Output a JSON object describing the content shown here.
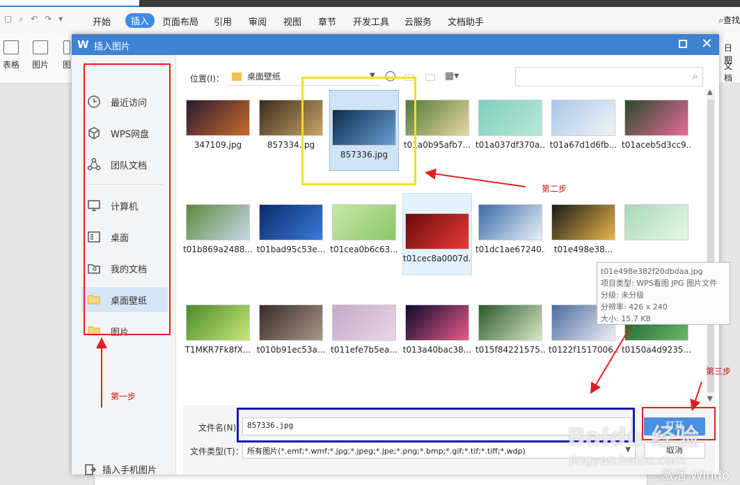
{
  "app": {
    "menu_tabs": [
      "开始",
      "插入",
      "页面布局",
      "引用",
      "审阅",
      "视图",
      "章节",
      "开发工具",
      "云服务",
      "文档助手"
    ],
    "active_tab": "插入",
    "search_label": "查找",
    "ribbon": {
      "table": "表格",
      "picture": "图片",
      "shape_partial": "图",
      "date_partial": "日期",
      "doc_partial": "文档"
    }
  },
  "dialog": {
    "title": "插入图片",
    "sidebar": {
      "items": [
        {
          "label": "最近访问",
          "icon": "clock-icon"
        },
        {
          "label": "WPS网盘",
          "icon": "cube-icon"
        },
        {
          "label": "团队文档",
          "icon": "team-icon"
        },
        {
          "label": "计算机",
          "icon": "monitor-icon"
        },
        {
          "label": "桌面",
          "icon": "desktop-icon"
        },
        {
          "label": "我的文档",
          "icon": "user-folder-icon"
        },
        {
          "label": "桌面壁纸",
          "icon": "folder-icon"
        },
        {
          "label": "图片",
          "icon": "folder-icon"
        }
      ],
      "selected": "桌面壁纸",
      "bottom": "插入手机图片"
    },
    "location": {
      "label": "位置(I)：",
      "value": "桌面壁纸"
    },
    "files": [
      {
        "name": "347109.jpg",
        "colors": [
          "#2a1a30",
          "#c86a2a"
        ]
      },
      {
        "name": "857334.jpg",
        "colors": [
          "#3b2a1a",
          "#c9a46a"
        ]
      },
      {
        "name": "857336.jpg",
        "colors": [
          "#0e2a4a",
          "#6aa0d8"
        ]
      },
      {
        "name": "t01a0b95afb7...",
        "colors": [
          "#4e7a3a",
          "#e9d7a0"
        ]
      },
      {
        "name": "t01a037df370a...",
        "colors": [
          "#7ecfc0",
          "#b8e8d8"
        ]
      },
      {
        "name": "t01a67d1d6fb...",
        "colors": [
          "#a8c8e8",
          "#f0f4f8"
        ]
      },
      {
        "name": "t01aceb5d3cc9...",
        "colors": [
          "#2a4a2a",
          "#e86a9a"
        ]
      },
      {
        "name": "t01b869a2488...",
        "colors": [
          "#5a8a3a",
          "#c8d8e8"
        ]
      },
      {
        "name": "t01bad95c53e...",
        "colors": [
          "#0a2a6a",
          "#3a7ad8"
        ]
      },
      {
        "name": "t01cea0b6c63...",
        "colors": [
          "#c8e8a8",
          "#8ac868"
        ]
      },
      {
        "name": "t01cec8a0007d...",
        "colors": [
          "#6a0a0a",
          "#e83a3a"
        ]
      },
      {
        "name": "t01dc1ae67240...",
        "colors": [
          "#3a6aa8",
          "#e8f0f8"
        ]
      },
      {
        "name": "t01e498e38...",
        "colors": [
          "#1a1a1a",
          "#e8b848"
        ]
      },
      {
        "name": "",
        "colors": [
          "#a8d8b8",
          "#e8f8e8"
        ]
      },
      {
        "name": "T1MKR7Fk8fX...",
        "colors": [
          "#4a8a2a",
          "#c8e878"
        ]
      },
      {
        "name": "t010b91ec53a...",
        "colors": [
          "#3a2a2a",
          "#a89888"
        ]
      },
      {
        "name": "t011efe7b5ea...",
        "colors": [
          "#c8a8c8",
          "#e8d8e8"
        ]
      },
      {
        "name": "t013a40bac38...",
        "colors": [
          "#0a0a2a",
          "#e85a8a"
        ]
      },
      {
        "name": "t015f84221575...",
        "colors": [
          "#2a5a2a",
          "#d8e8c8"
        ]
      },
      {
        "name": "t0122f1517006...",
        "colors": [
          "#4a6a9a",
          "#f0f0f8"
        ]
      },
      {
        "name": "t0150a4d9235...",
        "colors": [
          "#1a5a2a",
          "#6ab868"
        ]
      }
    ],
    "selected_file": "857336.jpg",
    "tooltip": {
      "filename": "t01e498e382f20dbdaa.jpg",
      "type": "项目类型: WPS看图 JPG 图片文件",
      "grade": "分级: 未分级",
      "resolution": "分辨率: 426 x 240",
      "size": "大小: 15.7 KB"
    },
    "filename_label": "文件名(N)：",
    "filename_value": "857336.jpg",
    "filetype_label": "文件类型(T)：",
    "filetype_value": "所有图片(*.emf;*.wmf;*.jpg;*.jpeg;*.jpe;*.png;*.bmp;*.gif;*.tif;*.tiff;*.wdp)",
    "open_label": "打开",
    "cancel_label": "取消"
  },
  "annotations": {
    "step1": "第一步",
    "step2": "第二步",
    "step3": "第三步"
  },
  "watermark": {
    "main": "Baidu 经验",
    "sub": "jingyan.baidu.com",
    "corner": "激活 Windo"
  },
  "colors": {
    "title_bar": "#3d82d3",
    "open_button": "#4a90e2",
    "annotation_red": "#e02020",
    "annotation_yellow": "#f0e020",
    "annotation_blue": "#1a1ab0"
  }
}
